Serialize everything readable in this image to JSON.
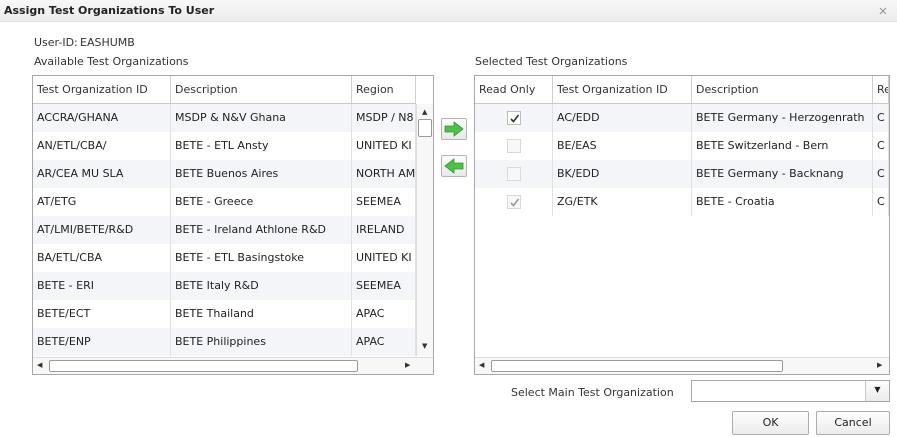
{
  "window": {
    "title": "Assign Test Organizations To User"
  },
  "user": {
    "label": "User-ID:",
    "value": "EASHUMB"
  },
  "available": {
    "label": "Available Test Organizations",
    "columns": [
      "Test Organization ID",
      "Description",
      "Region"
    ],
    "rows": [
      [
        "ACCRA/GHANA",
        "MSDP & N&V Ghana",
        "MSDP / N8"
      ],
      [
        "AN/ETL/CBA/",
        "BETE - ETL Ansty",
        "UNITED KI"
      ],
      [
        "AR/CEA MU SLA",
        "BETE Buenos Aires",
        "NORTH AM"
      ],
      [
        "AT/ETG",
        "BETE - Greece",
        "SEEMEA"
      ],
      [
        "AT/LMI/BETE/R&D",
        "BETE - Ireland Athlone R&D",
        "IRELAND"
      ],
      [
        "BA/ETL/CBA",
        "BETE - ETL Basingstoke",
        "UNITED KI"
      ],
      [
        "BETE - ERI",
        "BETE Italy R&D",
        "SEEMEA"
      ],
      [
        "BETE/ECT",
        "BETE Thailand",
        "APAC"
      ],
      [
        "BETE/ENP",
        "BETE Philippines",
        "APAC"
      ]
    ]
  },
  "selected": {
    "label": "Selected Test Organizations",
    "columns": [
      "Read Only",
      "Test Organization ID",
      "Description",
      "Re"
    ],
    "rows": [
      {
        "read_only": true,
        "enabled": true,
        "id": "AC/EDD",
        "description": "BETE Germany - Herzogenrath",
        "region": "C"
      },
      {
        "read_only": false,
        "enabled": false,
        "id": "BE/EAS",
        "description": "BETE Switzerland - Bern",
        "region": "C"
      },
      {
        "read_only": false,
        "enabled": false,
        "id": "BK/EDD",
        "description": "BETE Germany - Backnang",
        "region": "C"
      },
      {
        "read_only": true,
        "enabled": false,
        "id": "ZG/ETK",
        "description": "BETE - Croatia",
        "region": "C"
      }
    ]
  },
  "main_org": {
    "label": "Select Main Test Organization",
    "value": ""
  },
  "buttons": {
    "ok": "OK",
    "cancel": "Cancel"
  },
  "icons": {
    "add": "arrow-right-icon",
    "remove": "arrow-left-icon",
    "accent": "#4cc24c"
  }
}
